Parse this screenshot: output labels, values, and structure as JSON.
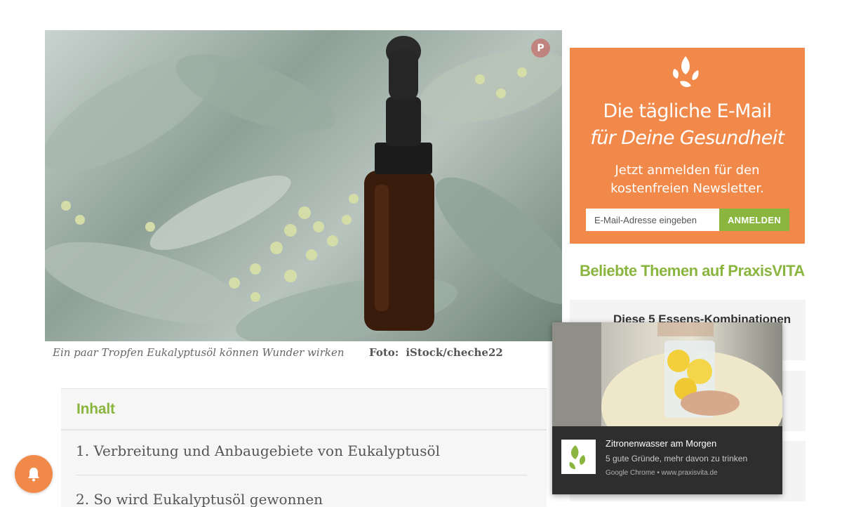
{
  "hero": {
    "caption": "Ein paar Tropfen Eukalyptusöl können Wunder wirken",
    "credit_label": "Foto:",
    "credit_value": "iStock/cheche22",
    "pin_icon": "pinterest-icon"
  },
  "toc": {
    "title": "Inhalt",
    "items": [
      "1. Verbreitung und Anbaugebiete von Eukalyptusöl",
      "2. So wird Eukalyptusöl gewonnen"
    ]
  },
  "newsletter": {
    "logo_icon": "drop-leaf-logo",
    "title": "Die tägliche E-Mail",
    "subtitle": "für Deine Gesundheit",
    "text_line1": "Jetzt anmelden für den",
    "text_line2": "kostenfreien Newsletter.",
    "email_placeholder": "E-Mail-Adresse eingeben",
    "button_label": "ANMELDEN",
    "colors": {
      "background": "#f1894a",
      "button": "#8ab53f"
    }
  },
  "topics": {
    "title": "Beliebte Themen auf PraxisVITA",
    "items": [
      "Diese 5 Essens-Kombinationen"
    ]
  },
  "notification": {
    "title": "Zitronenwasser am Morgen",
    "body": "5 gute Gründe, mehr davon zu trinken",
    "source": "Google Chrome • www.praxisvita.de"
  },
  "bell": {
    "icon": "bell-icon"
  },
  "colors": {
    "accent_green": "#8ab53f",
    "accent_orange": "#f1894a"
  }
}
